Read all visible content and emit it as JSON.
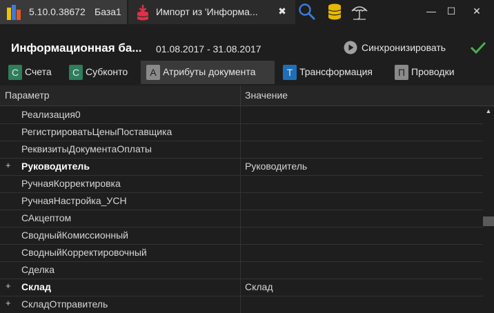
{
  "titlebar": {
    "version": "5.10.0.38672",
    "db_name": "База1",
    "import_tab_title": "Импорт из 'Информа...",
    "close_glyph": "✖",
    "minimize_glyph": "—",
    "maximize_glyph": "☐",
    "window_close_glyph": "✕",
    "icons": [
      "app-icon",
      "import-icon",
      "search-icon",
      "database-icon",
      "umbrella-icon"
    ]
  },
  "header": {
    "title": "Информационная ба...",
    "date_range": "01.08.2017 - 31.08.2017",
    "sync_label": "Синхронизировать",
    "accent_green": "#4caf50"
  },
  "tabs": [
    {
      "badge": "С",
      "label": "Счета",
      "color": "#2e7d5b",
      "active": false
    },
    {
      "badge": "С",
      "label": "Субконто",
      "color": "#2e7d5b",
      "active": false
    },
    {
      "badge": "А",
      "label": "Атрибуты документа",
      "color": "#8a8a8a",
      "active": true
    },
    {
      "badge": "Т",
      "label": "Трансформация",
      "color": "#1f6fb8",
      "active": false
    },
    {
      "badge": "П",
      "label": "Проводки",
      "color": "#8a8a8a",
      "active": false
    }
  ],
  "grid": {
    "columns": [
      "Параметр",
      "Значение"
    ],
    "rows": [
      {
        "expander": "",
        "param": "Реализация0",
        "value": "",
        "bold": false
      },
      {
        "expander": "",
        "param": "РегистрироватьЦеныПоставщика",
        "value": "",
        "bold": false
      },
      {
        "expander": "",
        "param": "РеквизитыДокументаОплаты",
        "value": "",
        "bold": false
      },
      {
        "expander": "+",
        "param": "Руководитель",
        "value": "Руководитель",
        "bold": true
      },
      {
        "expander": "",
        "param": "РучнаяКорректировка",
        "value": "",
        "bold": false
      },
      {
        "expander": "",
        "param": "РучнаяНастройка_УСН",
        "value": "",
        "bold": false
      },
      {
        "expander": "",
        "param": "САкцептом",
        "value": "",
        "bold": false
      },
      {
        "expander": "",
        "param": "СводныйКомиссионный",
        "value": "",
        "bold": false
      },
      {
        "expander": "",
        "param": "СводныйКорректировочный",
        "value": "",
        "bold": false
      },
      {
        "expander": "",
        "param": "Сделка",
        "value": "",
        "bold": false
      },
      {
        "expander": "+",
        "param": "Склад",
        "value": "Склад",
        "bold": true
      },
      {
        "expander": "+",
        "param": "СкладОтправитель",
        "value": "",
        "bold": false
      }
    ]
  }
}
